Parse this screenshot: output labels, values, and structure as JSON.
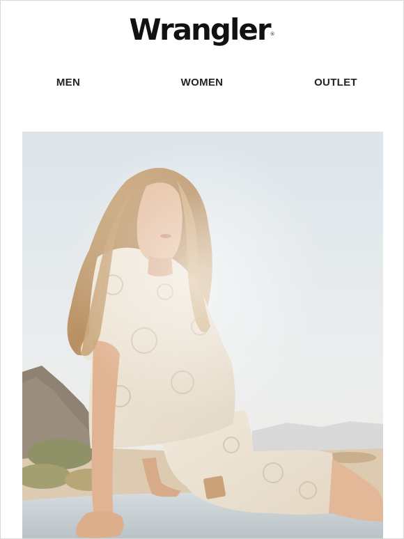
{
  "header": {
    "logo_text": "Wrangler",
    "logo_mark": "®"
  },
  "nav": {
    "items": [
      {
        "label": "MEN"
      },
      {
        "label": "WOMEN"
      },
      {
        "label": "OUTLET"
      }
    ]
  },
  "hero": {
    "image_label": "hero-photo-woman-floral-denim",
    "colors": {
      "sky": "#e4e9ec",
      "sand": "#d9c6ad",
      "outfit": "#eee4d4",
      "hair": "#c7a57a",
      "skin": "#e0b898"
    }
  }
}
